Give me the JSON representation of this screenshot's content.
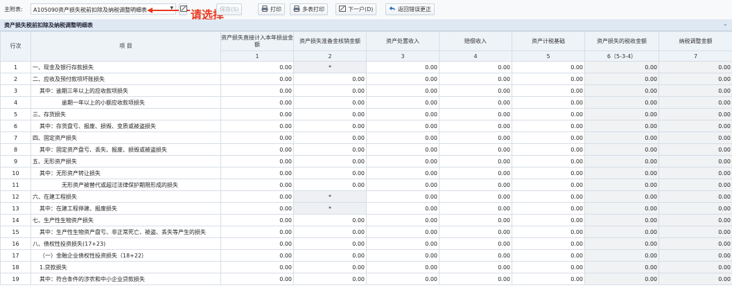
{
  "toolbar": {
    "label": "主附表:",
    "selected_table": "A105090资产损失税前扣除及纳税调整明细表",
    "save_label": "保存(S)",
    "print_label": "打印",
    "multi_print_label": "多表打印",
    "next_label": "下一户(D)",
    "return_label": "返回错误更正"
  },
  "annotation": {
    "text": "请选择",
    "color": "#e8361c"
  },
  "section": {
    "title": "资产损失税前扣除及纳税调整明细表"
  },
  "table": {
    "headers": [
      {
        "label": "行次"
      },
      {
        "label": "项 目"
      },
      {
        "label": "资产损失直接计入本年损益金额",
        "sub": "1"
      },
      {
        "label": "资产损失准备金核销金额",
        "sub": "2"
      },
      {
        "label": "资产处置收入",
        "sub": "3"
      },
      {
        "label": "赔偿收入",
        "sub": "4"
      },
      {
        "label": "资产计税基础",
        "sub": "5"
      },
      {
        "label": "资产损失的税收金额",
        "sub": "6（5-3-4）"
      },
      {
        "label": "纳税调整金额",
        "sub": "7"
      }
    ],
    "rows": [
      {
        "no": "1",
        "item": "一、现金及银行存款损失",
        "indent": 0,
        "c": [
          "0.00",
          "*",
          "0.00",
          "0.00",
          "0.00",
          "0.00",
          "0.00"
        ]
      },
      {
        "no": "2",
        "item": "二、应收及预付款项坏账损失",
        "indent": 0,
        "c": [
          "0.00",
          "0.00",
          "0.00",
          "0.00",
          "0.00",
          "0.00",
          "0.00"
        ]
      },
      {
        "no": "3",
        "item": "其中：逾期三年以上的应收款项损失",
        "indent": 1,
        "c": [
          "0.00",
          "0.00",
          "0.00",
          "0.00",
          "0.00",
          "0.00",
          "0.00"
        ]
      },
      {
        "no": "4",
        "item": "逾期一年以上的小额应收款项损失",
        "indent": 2,
        "c": [
          "0.00",
          "0.00",
          "0.00",
          "0.00",
          "0.00",
          "0.00",
          "0.00"
        ]
      },
      {
        "no": "5",
        "item": "三、存货损失",
        "indent": 0,
        "c": [
          "0.00",
          "0.00",
          "0.00",
          "0.00",
          "0.00",
          "0.00",
          "0.00"
        ]
      },
      {
        "no": "6",
        "item": "其中：存货盘亏、报废、损毁、变质或被盗损失",
        "indent": 1,
        "c": [
          "0.00",
          "0.00",
          "0.00",
          "0.00",
          "0.00",
          "0.00",
          "0.00"
        ]
      },
      {
        "no": "7",
        "item": "四、固定资产损失",
        "indent": 0,
        "c": [
          "0.00",
          "0.00",
          "0.00",
          "0.00",
          "0.00",
          "0.00",
          "0.00"
        ]
      },
      {
        "no": "8",
        "item": "其中：固定资产盘亏、丢失、报废、损毁或被盗损失",
        "indent": 1,
        "c": [
          "0.00",
          "0.00",
          "0.00",
          "0.00",
          "0.00",
          "0.00",
          "0.00"
        ]
      },
      {
        "no": "9",
        "item": "五、无形资产损失",
        "indent": 0,
        "c": [
          "0.00",
          "0.00",
          "0.00",
          "0.00",
          "0.00",
          "0.00",
          "0.00"
        ]
      },
      {
        "no": "10",
        "item": "其中：无形资产转让损失",
        "indent": 1,
        "c": [
          "0.00",
          "0.00",
          "0.00",
          "0.00",
          "0.00",
          "0.00",
          "0.00"
        ]
      },
      {
        "no": "11",
        "item": "无形资产被替代或超过法律保护期限形成的损失",
        "indent": 2,
        "c": [
          "0.00",
          "0.00",
          "0.00",
          "0.00",
          "0.00",
          "0.00",
          "0.00"
        ]
      },
      {
        "no": "12",
        "item": "六、在建工程损失",
        "indent": 0,
        "c": [
          "0.00",
          "*",
          "0.00",
          "0.00",
          "0.00",
          "0.00",
          "0.00"
        ]
      },
      {
        "no": "13",
        "item": "其中：在建工程停建、报废损失",
        "indent": 1,
        "c": [
          "0.00",
          "*",
          "0.00",
          "0.00",
          "0.00",
          "0.00",
          "0.00"
        ]
      },
      {
        "no": "14",
        "item": "七、生产性生物资产损失",
        "indent": 0,
        "c": [
          "0.00",
          "0.00",
          "0.00",
          "0.00",
          "0.00",
          "0.00",
          "0.00"
        ]
      },
      {
        "no": "15",
        "item": "其中：生产性生物资产盘亏、非正常死亡、被盗、丢失等产生的损失",
        "indent": 1,
        "c": [
          "0.00",
          "0.00",
          "0.00",
          "0.00",
          "0.00",
          "0.00",
          "0.00"
        ]
      },
      {
        "no": "16",
        "item": "八、债权性投资损失(17+23)",
        "indent": 0,
        "c": [
          "0.00",
          "0.00",
          "0.00",
          "0.00",
          "0.00",
          "0.00",
          "0.00"
        ]
      },
      {
        "no": "17",
        "item": "（一）金融企业债权性投资损失（18+22）",
        "indent": 1,
        "c": [
          "0.00",
          "0.00",
          "0.00",
          "0.00",
          "0.00",
          "0.00",
          "0.00"
        ]
      },
      {
        "no": "18",
        "item": "1.贷款损失",
        "indent": 1,
        "c": [
          "0.00",
          "0.00",
          "0.00",
          "0.00",
          "0.00",
          "0.00",
          "0.00"
        ]
      },
      {
        "no": "19",
        "item": "其中：符合条件的涉农和中小企业贷款损失",
        "indent": 1,
        "c": [
          "0.00",
          "0.00",
          "0.00",
          "0.00",
          "0.00",
          "0.00",
          "0.00"
        ]
      }
    ]
  },
  "icons": {
    "save": "save-icon",
    "print": "printer-icon",
    "multi_print": "printer-icon",
    "next": "edit-icon",
    "return": "return-arrow-icon",
    "dropdown": "chevron-down-icon",
    "collapse": "chevron-down-icon"
  }
}
